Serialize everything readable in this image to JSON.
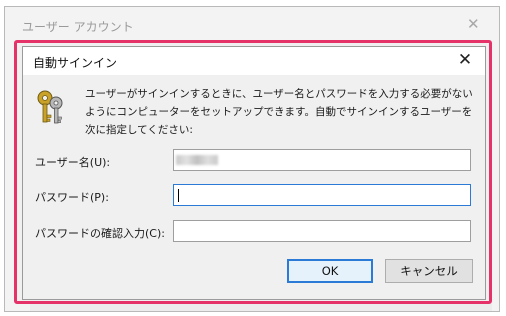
{
  "background_window": {
    "title": "ユーザー アカウント",
    "close_glyph": "✕"
  },
  "dialog": {
    "title": "自動サインイン",
    "close_glyph": "✕",
    "icon": "keys-icon",
    "description": "ユーザーがサインインするときに、ユーザー名とパスワードを入力する必要がないようにコンピューターをセットアップできます。自動でサインインするユーザーを次に指定してください:",
    "fields": {
      "username": {
        "label": "ユーザー名(U):",
        "value": ""
      },
      "password": {
        "label": "パスワード(P):",
        "value": ""
      },
      "confirm_password": {
        "label": "パスワードの確認入力(C):",
        "value": ""
      }
    },
    "buttons": {
      "ok": "OK",
      "cancel": "キャンセル"
    }
  },
  "colors": {
    "highlight_border": "#e5336a",
    "focus_border": "#2b7ad6",
    "dialog_background": "#f0f0f0"
  }
}
